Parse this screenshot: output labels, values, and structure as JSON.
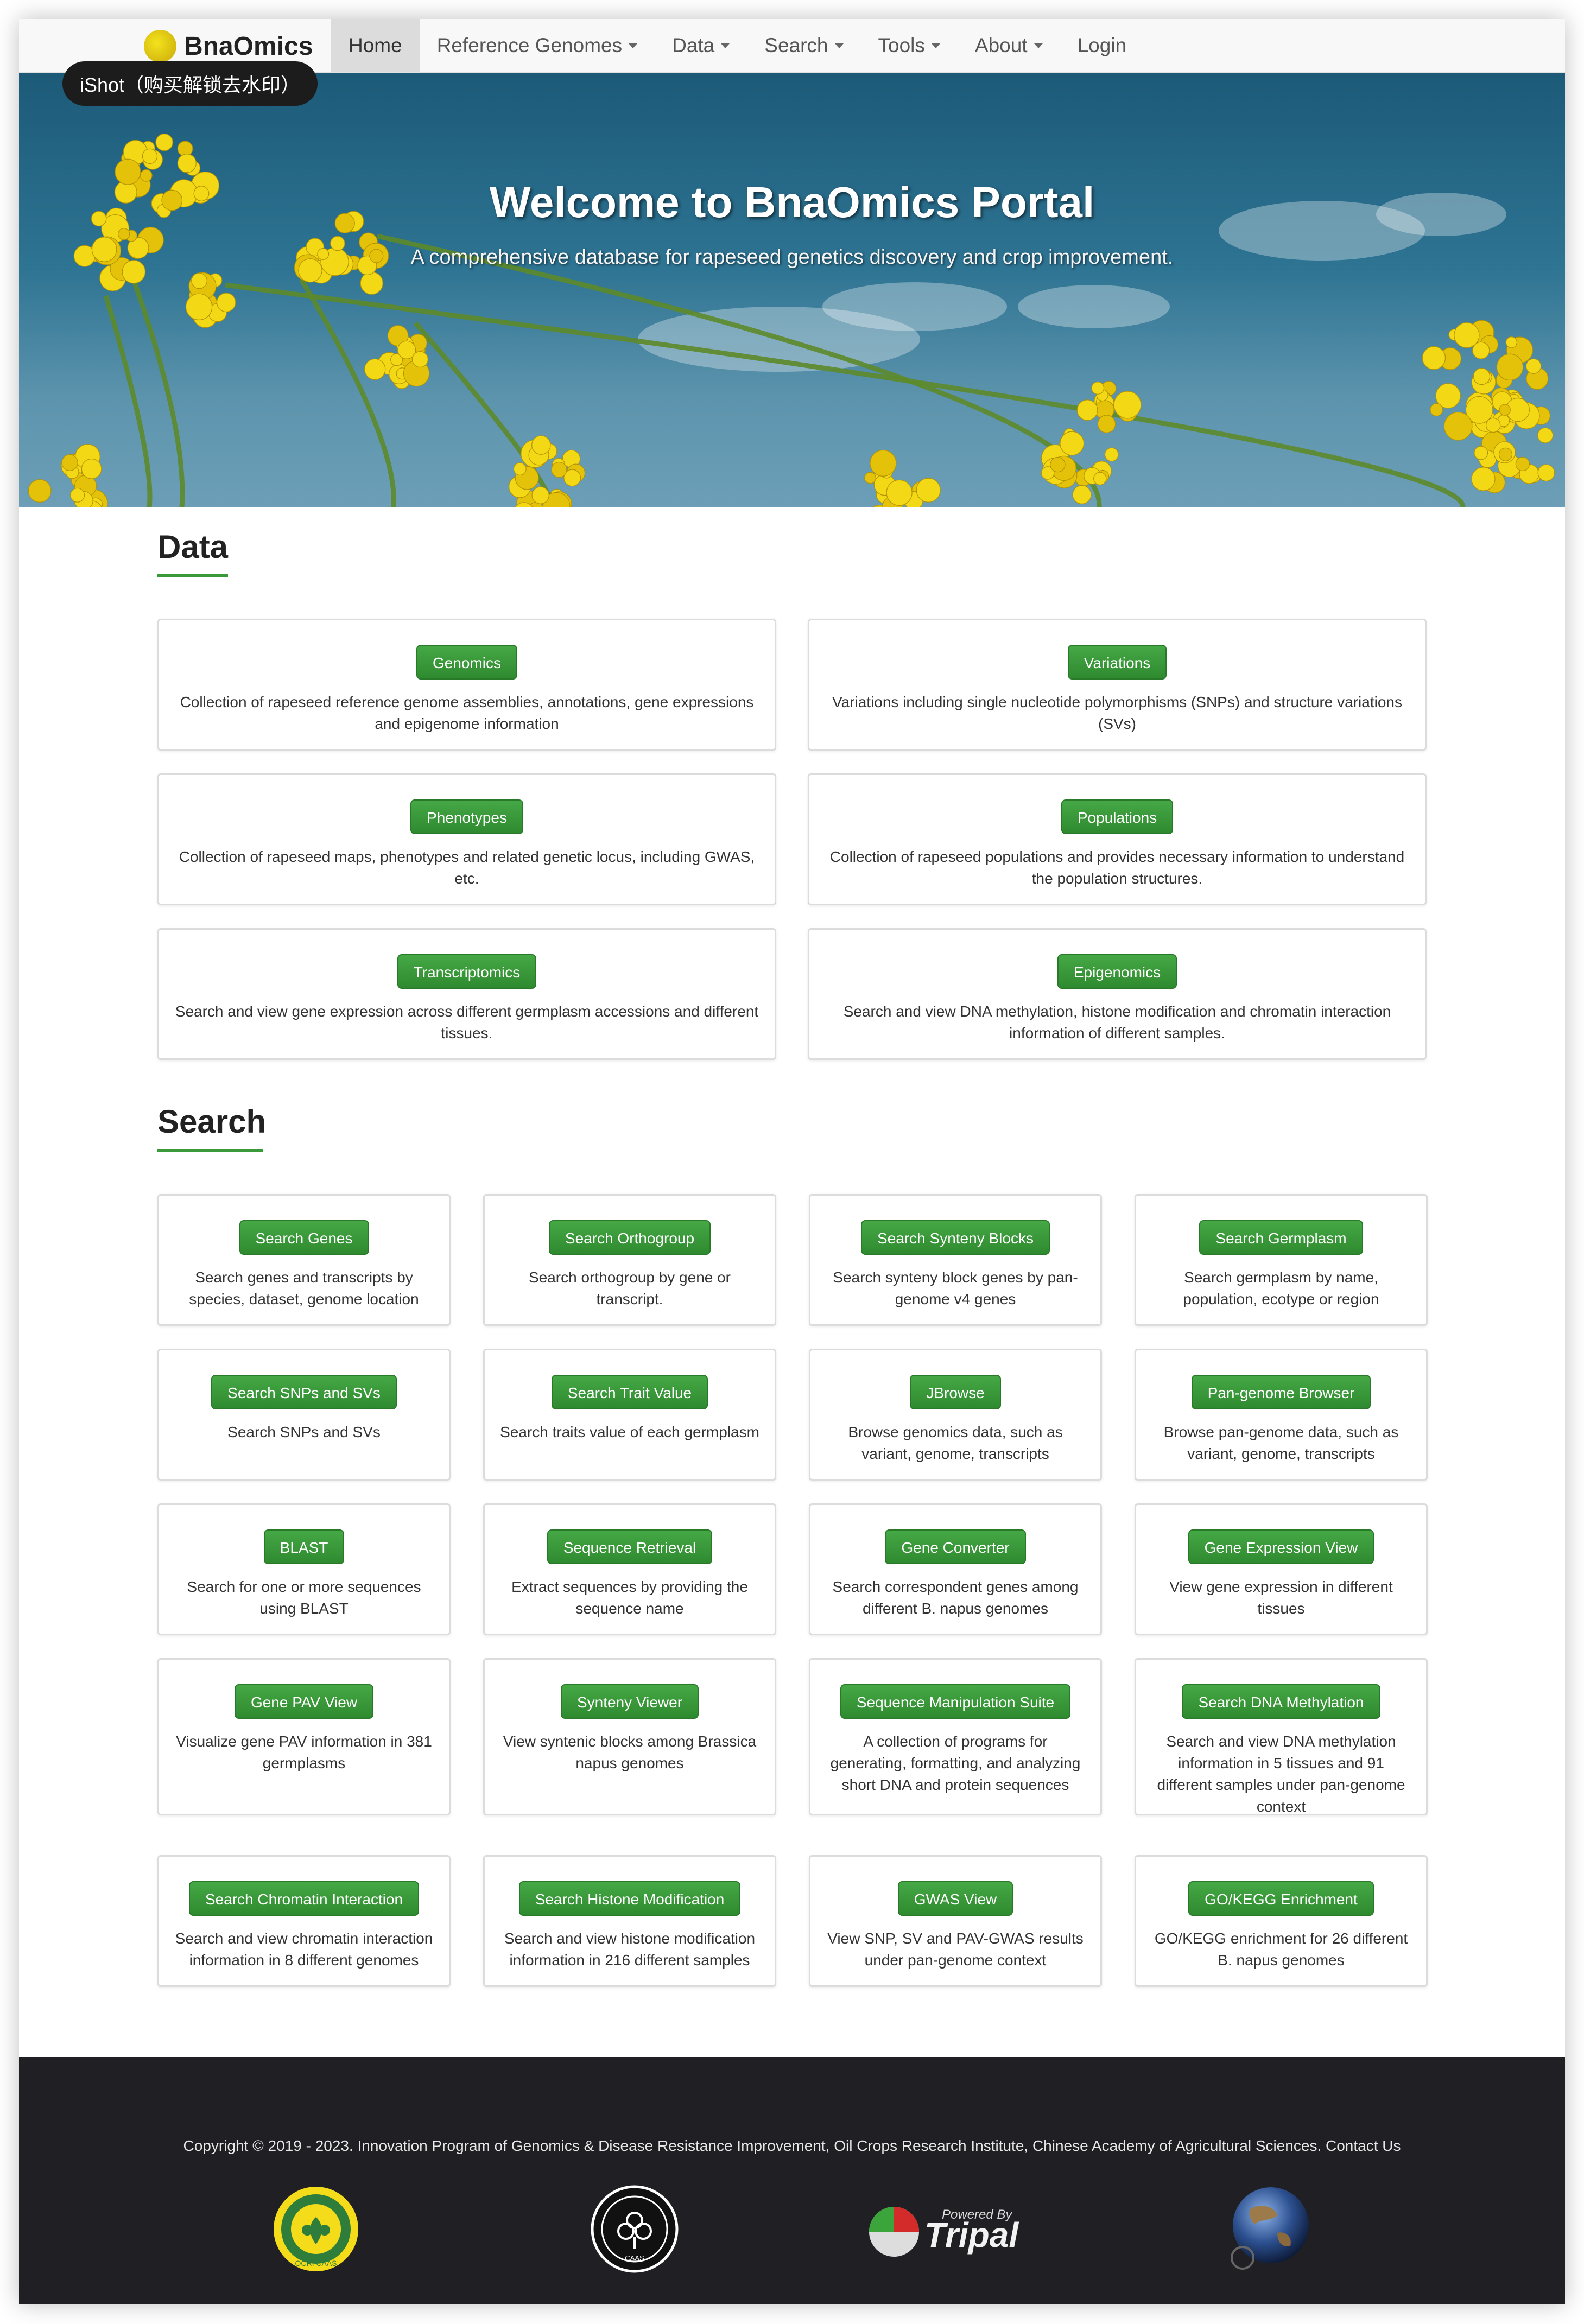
{
  "brand": {
    "name": "BnaOmics"
  },
  "watermark": {
    "text": "iShot（购买解锁去水印）"
  },
  "nav": {
    "items": [
      {
        "label": "Home",
        "dropdown": false
      },
      {
        "label": "Reference Genomes",
        "dropdown": true
      },
      {
        "label": "Data",
        "dropdown": true
      },
      {
        "label": "Search",
        "dropdown": true
      },
      {
        "label": "Tools",
        "dropdown": true
      },
      {
        "label": "About",
        "dropdown": true
      },
      {
        "label": "Login",
        "dropdown": false
      }
    ]
  },
  "hero": {
    "title": "Welcome to BnaOmics Portal",
    "subtitle": "A comprehensive database for rapeseed genetics discovery and crop improvement."
  },
  "data_section": {
    "title": "Data",
    "cards": [
      {
        "button": "Genomics",
        "desc": "Collection of rapeseed reference genome assemblies, annotations, gene expressions and epigenome information"
      },
      {
        "button": "Variations",
        "desc": "Variations including single nucleotide polymorphisms (SNPs) and structure variations (SVs)"
      },
      {
        "button": "Phenotypes",
        "desc": "Collection of rapeseed maps, phenotypes and related genetic locus, including GWAS, etc."
      },
      {
        "button": "Populations",
        "desc": "Collection of rapeseed populations and provides necessary information to understand the population structures."
      },
      {
        "button": "Transcriptomics",
        "desc": "Search and view gene expression across different germplasm accessions and different tissues."
      },
      {
        "button": "Epigenomics",
        "desc": "Search and view DNA methylation, histone modification and chromatin interaction information of different samples."
      }
    ]
  },
  "search_section": {
    "title": "Search",
    "cards": [
      {
        "button": "Search Genes",
        "desc": "Search genes and transcripts by species, dataset, genome location"
      },
      {
        "button": "Search Orthogroup",
        "desc": "Search orthogroup by gene or transcript."
      },
      {
        "button": "Search Synteny Blocks",
        "desc": "Search synteny block genes by pan-genome v4 genes"
      },
      {
        "button": "Search Germplasm",
        "desc": "Search germplasm by name, population, ecotype or region"
      },
      {
        "button": "Search SNPs and SVs",
        "desc": "Search SNPs and SVs"
      },
      {
        "button": "Search Trait Value",
        "desc": "Search traits value of each germplasm"
      },
      {
        "button": "JBrowse",
        "desc": "Browse genomics data, such as variant, genome, transcripts"
      },
      {
        "button": "Pan-genome Browser",
        "desc": "Browse pan-genome data, such as variant, genome, transcripts"
      },
      {
        "button": "BLAST",
        "desc": "Search for one or more sequences using BLAST"
      },
      {
        "button": "Sequence Retrieval",
        "desc": "Extract sequences by providing the sequence name"
      },
      {
        "button": "Gene Converter",
        "desc": "Search correspondent genes among different B. napus genomes"
      },
      {
        "button": "Gene Expression View",
        "desc": "View gene expression in different tissues"
      },
      {
        "button": "Gene PAV View",
        "desc": "Visualize gene PAV information in 381 germplasms"
      },
      {
        "button": "Synteny Viewer",
        "desc": "View syntenic blocks among Brassica napus genomes"
      },
      {
        "button": "Sequence Manipulation Suite",
        "desc": "A collection of programs for generating, formatting, and analyzing short DNA and protein sequences"
      },
      {
        "button": "Search DNA Methylation",
        "desc": "Search and view DNA methylation information in 5 tissues and 91 different samples under pan-genome context"
      },
      {
        "button": "Search Chromatin Interaction",
        "desc": "Search and view chromatin interaction information in 8 different genomes"
      },
      {
        "button": "Search Histone Modification",
        "desc": "Search and view histone modification information in 216 different samples"
      },
      {
        "button": "GWAS View",
        "desc": "View SNP, SV and PAV-GWAS results under pan-genome context"
      },
      {
        "button": "GO/KEGG Enrichment",
        "desc": "GO/KEGG enrichment for 26 different B. napus genomes"
      }
    ]
  },
  "footer": {
    "copyright": "Copyright © 2019 - 2023. Innovation Program of Genomics & Disease Resistance Improvement, Oil Crops Research Institute, Chinese Academy of Agricultural Sciences. Contact Us",
    "logos": [
      {
        "name": "ocri-caas-logo",
        "text": "OCRI CAAS"
      },
      {
        "name": "caas-logo",
        "text": "CAAS"
      },
      {
        "name": "tripal-logo",
        "text": "Tripal",
        "powered_by": "Powered By"
      },
      {
        "name": "globe-logo"
      }
    ]
  },
  "colors": {
    "accent_green": "#3a9a3a",
    "hero_sky": "#2e7493",
    "footer_bg": "#1f1f24",
    "flower": "#f2d40f"
  }
}
